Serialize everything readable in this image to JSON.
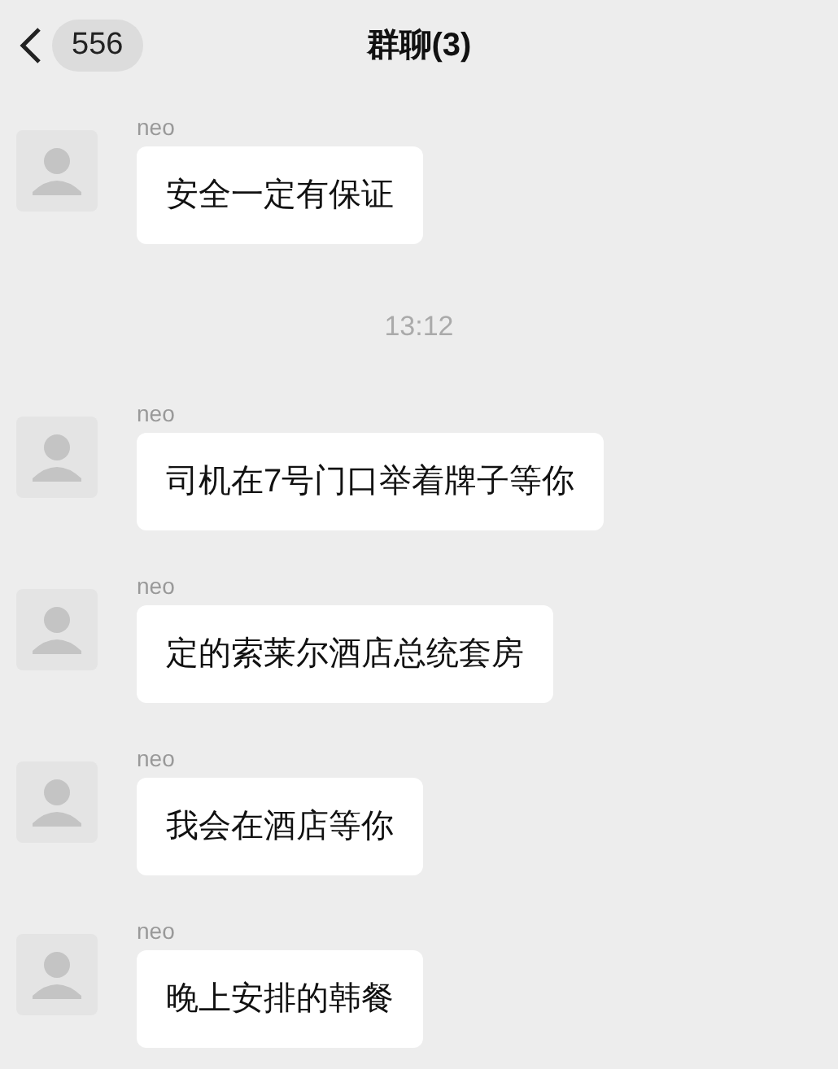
{
  "header": {
    "back_count": "556",
    "title": "群聊(3)"
  },
  "items": [
    {
      "kind": "message",
      "sender": "neo",
      "text": "安全一定有保证"
    },
    {
      "kind": "time",
      "text": "13:12"
    },
    {
      "kind": "message",
      "sender": "neo",
      "text": "司机在7号门口举着牌子等你"
    },
    {
      "kind": "message",
      "sender": "neo",
      "text": "定的索莱尔酒店总统套房"
    },
    {
      "kind": "message",
      "sender": "neo",
      "text": "我会在酒店等你"
    },
    {
      "kind": "message",
      "sender": "neo",
      "text": "晚上安排的韩餐"
    }
  ]
}
